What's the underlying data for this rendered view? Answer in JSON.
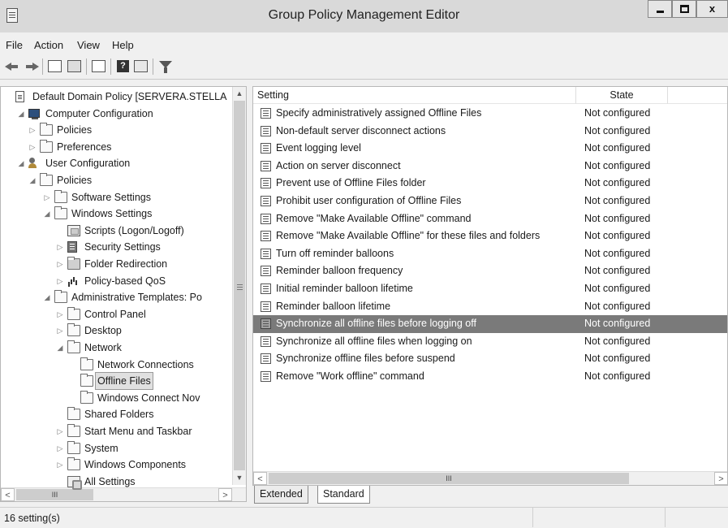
{
  "window": {
    "title": "Group Policy Management Editor",
    "close_glyph": "x"
  },
  "menu": [
    "File",
    "Action",
    "View",
    "Help"
  ],
  "toolbar": {
    "help_glyph": "?"
  },
  "tree": [
    {
      "label": "Default Domain Policy [SERVERA.STELLA",
      "expander": "",
      "icon": "policy-doc"
    },
    {
      "label": "Computer Configuration",
      "expander": "◢",
      "icon": "computer"
    },
    {
      "label": "Policies",
      "expander": "▷",
      "icon": "folder"
    },
    {
      "label": "Preferences",
      "expander": "▷",
      "icon": "folder"
    },
    {
      "label": "User Configuration",
      "expander": "◢",
      "icon": "user"
    },
    {
      "label": "Policies",
      "expander": "◢",
      "icon": "folder"
    },
    {
      "label": "Software Settings",
      "expander": "▷",
      "icon": "folder"
    },
    {
      "label": "Windows Settings",
      "expander": "◢",
      "icon": "folder"
    },
    {
      "label": "Scripts (Logon/Logoff)",
      "expander": "",
      "icon": "scripts"
    },
    {
      "label": "Security Settings",
      "expander": "▷",
      "icon": "security"
    },
    {
      "label": "Folder Redirection",
      "expander": "▷",
      "icon": "folder-dark"
    },
    {
      "label": "Policy-based QoS",
      "expander": "▷",
      "icon": "chart"
    },
    {
      "label": "Administrative Templates: Po",
      "expander": "◢",
      "icon": "folder"
    },
    {
      "label": "Control Panel",
      "expander": "▷",
      "icon": "folder"
    },
    {
      "label": "Desktop",
      "expander": "▷",
      "icon": "folder"
    },
    {
      "label": "Network",
      "expander": "◢",
      "icon": "folder"
    },
    {
      "label": "Network Connections",
      "expander": "",
      "icon": "folder"
    },
    {
      "label": "Offline Files",
      "expander": "",
      "icon": "folder"
    },
    {
      "label": "Windows Connect Nov",
      "expander": "",
      "icon": "folder"
    },
    {
      "label": "Shared Folders",
      "expander": "",
      "icon": "folder"
    },
    {
      "label": "Start Menu and Taskbar",
      "expander": "▷",
      "icon": "folder"
    },
    {
      "label": "System",
      "expander": "▷",
      "icon": "folder"
    },
    {
      "label": "Windows Components",
      "expander": "▷",
      "icon": "folder"
    },
    {
      "label": "All Settings",
      "expander": "",
      "icon": "all-settings"
    }
  ],
  "tree_scroll": {
    "left": "<",
    "right": ">",
    "grip": "III"
  },
  "list": {
    "columns": {
      "setting": "Setting",
      "state": "State"
    },
    "rows": [
      {
        "setting": "Specify administratively assigned Offline Files",
        "state": "Not configured"
      },
      {
        "setting": "Non-default server disconnect actions",
        "state": "Not configured"
      },
      {
        "setting": "Event logging level",
        "state": "Not configured"
      },
      {
        "setting": "Action on server disconnect",
        "state": "Not configured"
      },
      {
        "setting": "Prevent use of Offline Files folder",
        "state": "Not configured"
      },
      {
        "setting": "Prohibit user configuration of Offline Files",
        "state": "Not configured"
      },
      {
        "setting": "Remove \"Make Available Offline\" command",
        "state": "Not configured"
      },
      {
        "setting": "Remove \"Make Available Offline\" for these files and folders",
        "state": "Not configured"
      },
      {
        "setting": "Turn off reminder balloons",
        "state": "Not configured"
      },
      {
        "setting": "Reminder balloon frequency",
        "state": "Not configured"
      },
      {
        "setting": "Initial reminder balloon lifetime",
        "state": "Not configured"
      },
      {
        "setting": "Reminder balloon lifetime",
        "state": "Not configured"
      },
      {
        "setting": "Synchronize all offline files before logging off",
        "state": "Not configured"
      },
      {
        "setting": "Synchronize all offline files when logging on",
        "state": "Not configured"
      },
      {
        "setting": "Synchronize offline files before suspend",
        "state": "Not configured"
      },
      {
        "setting": "Remove \"Work offline\" command",
        "state": "Not configured"
      }
    ]
  },
  "list_scroll": {
    "left": "<",
    "right": ">",
    "grip": "III"
  },
  "tabs": {
    "extended": "Extended",
    "standard": "Standard"
  },
  "status": {
    "text": "16 setting(s)"
  }
}
